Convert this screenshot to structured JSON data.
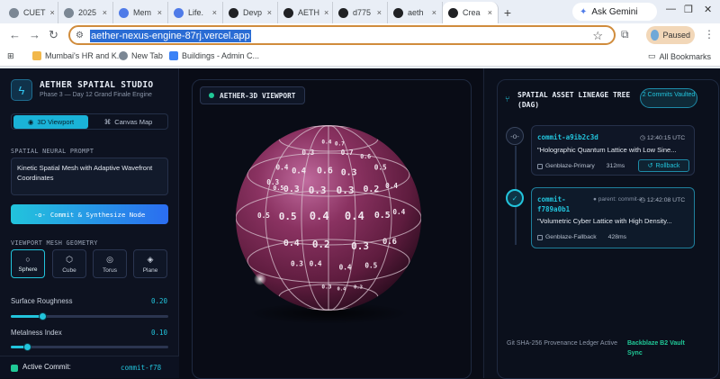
{
  "browser": {
    "tabs": [
      {
        "label": "CUET",
        "color": "#7b8794"
      },
      {
        "label": "2025",
        "color": "#7b8794"
      },
      {
        "label": "Mem",
        "color": "#4f7be8"
      },
      {
        "label": "Life.",
        "color": "#4f7be8"
      },
      {
        "label": "Devp",
        "color": "#202124"
      },
      {
        "label": "AETH",
        "color": "#202124"
      },
      {
        "label": "d775",
        "color": "#202124"
      },
      {
        "label": "aeth",
        "color": "#202124"
      },
      {
        "label": "Crea",
        "color": "#202124"
      }
    ],
    "new_tab_icon": "plus-icon",
    "gemini_label": "Ask Gemini",
    "url": "aether-nexus-engine-87rj.vercel.app",
    "profile_label": "Paused",
    "bookmarks": [
      "Mumbai's HR and K...",
      "New Tab",
      "Buildings - Admin C..."
    ],
    "all_bookmarks": "All Bookmarks"
  },
  "sidebar": {
    "title": "AETHER SPATIAL STUDIO",
    "subtitle": "Phase 3 — Day 12 Grand Finale Engine",
    "tabs": {
      "viewport": "3D Viewport",
      "canvas": "Canvas Map"
    },
    "prompt_label": "SPATIAL NEURAL PROMPT",
    "prompt_text": "Kinetic Spatial Mesh with Adaptive Wavefront Coordinates",
    "commit_button": "Commit & Synthesize Node",
    "geometry_label": "VIEWPORT MESH GEOMETRY",
    "geometries": [
      {
        "label": "Sphere",
        "icon": "circle-icon"
      },
      {
        "label": "Cube",
        "icon": "cube-icon"
      },
      {
        "label": "Torus",
        "icon": "torus-icon"
      },
      {
        "label": "Plane",
        "icon": "layers-icon"
      }
    ],
    "roughness": {
      "label": "Surface Roughness",
      "value": "0.20",
      "fraction": 0.2
    },
    "metalness": {
      "label": "Metalness Index",
      "value": "0.10",
      "fraction": 0.1
    },
    "active_commit": {
      "label": "Active Commit:",
      "value": "commit-f78"
    }
  },
  "viewport": {
    "tag": "AETHER-3D VIEWPORT",
    "sphere_labels": [
      {
        "text": "0.4",
        "u": 0.49,
        "v": 0.1,
        "s": 0.55
      },
      {
        "text": "0.7",
        "u": 0.56,
        "v": 0.11,
        "s": 0.55
      },
      {
        "text": "0.3",
        "u": 0.39,
        "v": 0.16,
        "s": 0.7
      },
      {
        "text": "0.7",
        "u": 0.6,
        "v": 0.16,
        "s": 0.7
      },
      {
        "text": "0.6",
        "u": 0.7,
        "v": 0.18,
        "s": 0.6
      },
      {
        "text": "0.4",
        "u": 0.25,
        "v": 0.24,
        "s": 0.7
      },
      {
        "text": "0.4",
        "u": 0.34,
        "v": 0.26,
        "s": 0.8
      },
      {
        "text": "0.6",
        "u": 0.48,
        "v": 0.26,
        "s": 0.9
      },
      {
        "text": "0.3",
        "u": 0.61,
        "v": 0.27,
        "s": 0.9
      },
      {
        "text": "0.5",
        "u": 0.78,
        "v": 0.24,
        "s": 0.7
      },
      {
        "text": "0.3",
        "u": 0.2,
        "v": 0.32,
        "s": 0.7
      },
      {
        "text": "0.5",
        "u": 0.23,
        "v": 0.35,
        "s": 0.6
      },
      {
        "text": "0.3",
        "u": 0.3,
        "v": 0.36,
        "s": 0.9
      },
      {
        "text": "0.3",
        "u": 0.44,
        "v": 0.37,
        "s": 1.0
      },
      {
        "text": "0.3",
        "u": 0.59,
        "v": 0.37,
        "s": 1.0
      },
      {
        "text": "0.2",
        "u": 0.73,
        "v": 0.36,
        "s": 0.9
      },
      {
        "text": "0.4",
        "u": 0.84,
        "v": 0.34,
        "s": 0.7
      },
      {
        "text": "0.5",
        "u": 0.15,
        "v": 0.5,
        "s": 0.7
      },
      {
        "text": "0.5",
        "u": 0.28,
        "v": 0.51,
        "s": 1.0
      },
      {
        "text": "0.4",
        "u": 0.45,
        "v": 0.51,
        "s": 1.1
      },
      {
        "text": "0.4",
        "u": 0.64,
        "v": 0.51,
        "s": 1.1
      },
      {
        "text": "0.5",
        "u": 0.79,
        "v": 0.5,
        "s": 0.9
      },
      {
        "text": "0.4",
        "u": 0.88,
        "v": 0.48,
        "s": 0.7
      },
      {
        "text": "0.4",
        "u": 0.3,
        "v": 0.65,
        "s": 0.9
      },
      {
        "text": "0.2",
        "u": 0.46,
        "v": 0.66,
        "s": 1.0
      },
      {
        "text": "0.3",
        "u": 0.67,
        "v": 0.67,
        "s": 1.0
      },
      {
        "text": "0.6",
        "u": 0.83,
        "v": 0.64,
        "s": 0.8
      },
      {
        "text": "0.3",
        "u": 0.33,
        "v": 0.76,
        "s": 0.7
      },
      {
        "text": "0.4",
        "u": 0.43,
        "v": 0.76,
        "s": 0.7
      },
      {
        "text": "0.4",
        "u": 0.59,
        "v": 0.78,
        "s": 0.7
      },
      {
        "text": "0.5",
        "u": 0.73,
        "v": 0.77,
        "s": 0.7
      },
      {
        "text": "0.3",
        "u": 0.49,
        "v": 0.88,
        "s": 0.55
      },
      {
        "text": "0.4",
        "u": 0.57,
        "v": 0.89,
        "s": 0.5
      },
      {
        "text": "0.3",
        "u": 0.66,
        "v": 0.88,
        "s": 0.5
      }
    ]
  },
  "dag": {
    "title": "SPATIAL ASSET LINEAGE TREE (DAG)",
    "badge": "2 Commits Vaulted",
    "commits": [
      {
        "hash": "commit-a9ib2c3d",
        "time": "12:40:15 UTC",
        "message": "\"Holographic Quantum Lattice with Low Sine...",
        "engine": "Genblaze-Primary",
        "latency": "312ms",
        "rollback": "Rollback"
      },
      {
        "hash": "commit-f789a0b1",
        "parent": "parent: commit-a",
        "time": "12:42:08 UTC",
        "message": "\"Volumetric Cyber Lattice with High Density...",
        "engine": "Genblaze-Fallback",
        "latency": "428ms"
      }
    ],
    "footer_left": "Git SHA-256 Provenance Ledger Active",
    "footer_right": "Backblaze B2 Vault Sync"
  },
  "colors": {
    "accent": "#22c4dc",
    "success": "#20c997",
    "sphere": "#7a2850"
  }
}
